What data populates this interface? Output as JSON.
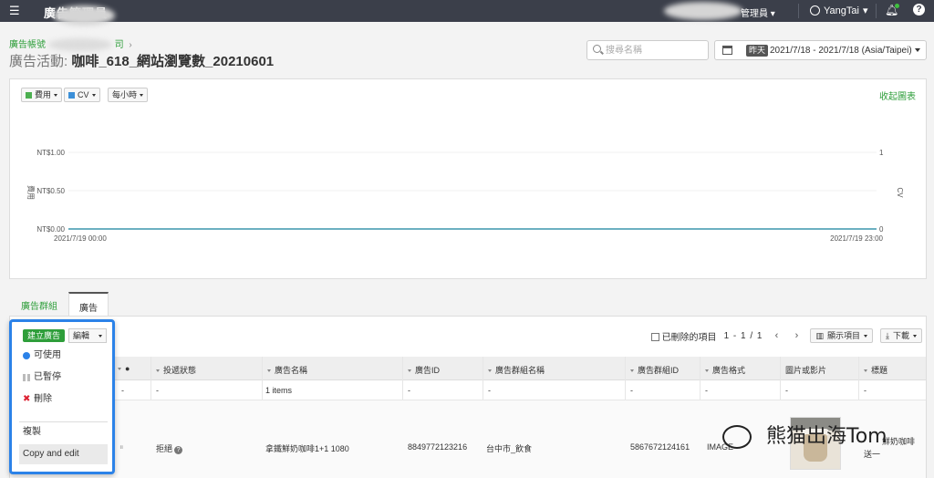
{
  "topbar": {
    "app_title": "廣告管理員",
    "account_label": "管理員",
    "user_name": "YangTai"
  },
  "header": {
    "breadcrumb_link": "廣告帳號",
    "breadcrumb_company": "司",
    "title_prefix": "廣告活動:",
    "campaign_name": "咖啡_618_網站瀏覽數_20210601"
  },
  "search": {
    "placeholder": "搜尋名稱"
  },
  "date_range": {
    "badge": "昨天",
    "range": "2021/7/18 - 2021/7/18 (Asia/Taipei)"
  },
  "chart_controls": {
    "metric1": "費用",
    "metric2": "CV",
    "interval": "每小時",
    "collapse": "收起圖表"
  },
  "chart_data": {
    "type": "line",
    "x_start_label": "2021/7/19 00:00",
    "x_end_label": "2021/7/19 23:00",
    "y_left_ticks": [
      "NT$1.00",
      "NT$0.50",
      "NT$0.00"
    ],
    "y_right_ticks": [
      "1",
      "0"
    ],
    "y_left_label": "費用",
    "y_right_label": "CV",
    "ylim_left": [
      0,
      1
    ],
    "ylim_right": [
      0,
      1
    ],
    "series": [
      {
        "name": "費用",
        "color": "#4caf50",
        "values": [
          0,
          0
        ]
      },
      {
        "name": "CV",
        "color": "#3b8fd8",
        "values": [
          0,
          0
        ]
      }
    ]
  },
  "tabs": [
    {
      "label": "廣告群組"
    },
    {
      "label": "廣告"
    }
  ],
  "toolbar": {
    "create_label": "建立廣告",
    "edit_label": "編輯",
    "show_deleted": "已刪除的項目",
    "pager": "1 - 1 / 1",
    "columns_btn": "顯示項目",
    "download_btn": "下載"
  },
  "edit_menu": {
    "items": [
      "可使用",
      "已暫停",
      "刪除",
      "複製",
      "Copy and edit"
    ]
  },
  "table": {
    "headers": [
      "投遞狀態",
      "廣告名稱",
      "廣告ID",
      "廣告群組名稱",
      "廣告群組ID",
      "廣告格式",
      "圖片或影片",
      "標題"
    ],
    "summary": {
      "dash": "-",
      "items": "1 items"
    },
    "row": {
      "status": "拒絕",
      "ad_name": "拿鐵鮮奶咖啡1+1 1080",
      "ad_id": "8849772123216",
      "group_name": "台中市_飲食",
      "group_id": "5867672124161",
      "format": "IMAGE",
      "title_line1": "鮮奶咖啡",
      "title_line2": "送一"
    }
  },
  "watermark": {
    "text": "熊猫出海Tom"
  }
}
